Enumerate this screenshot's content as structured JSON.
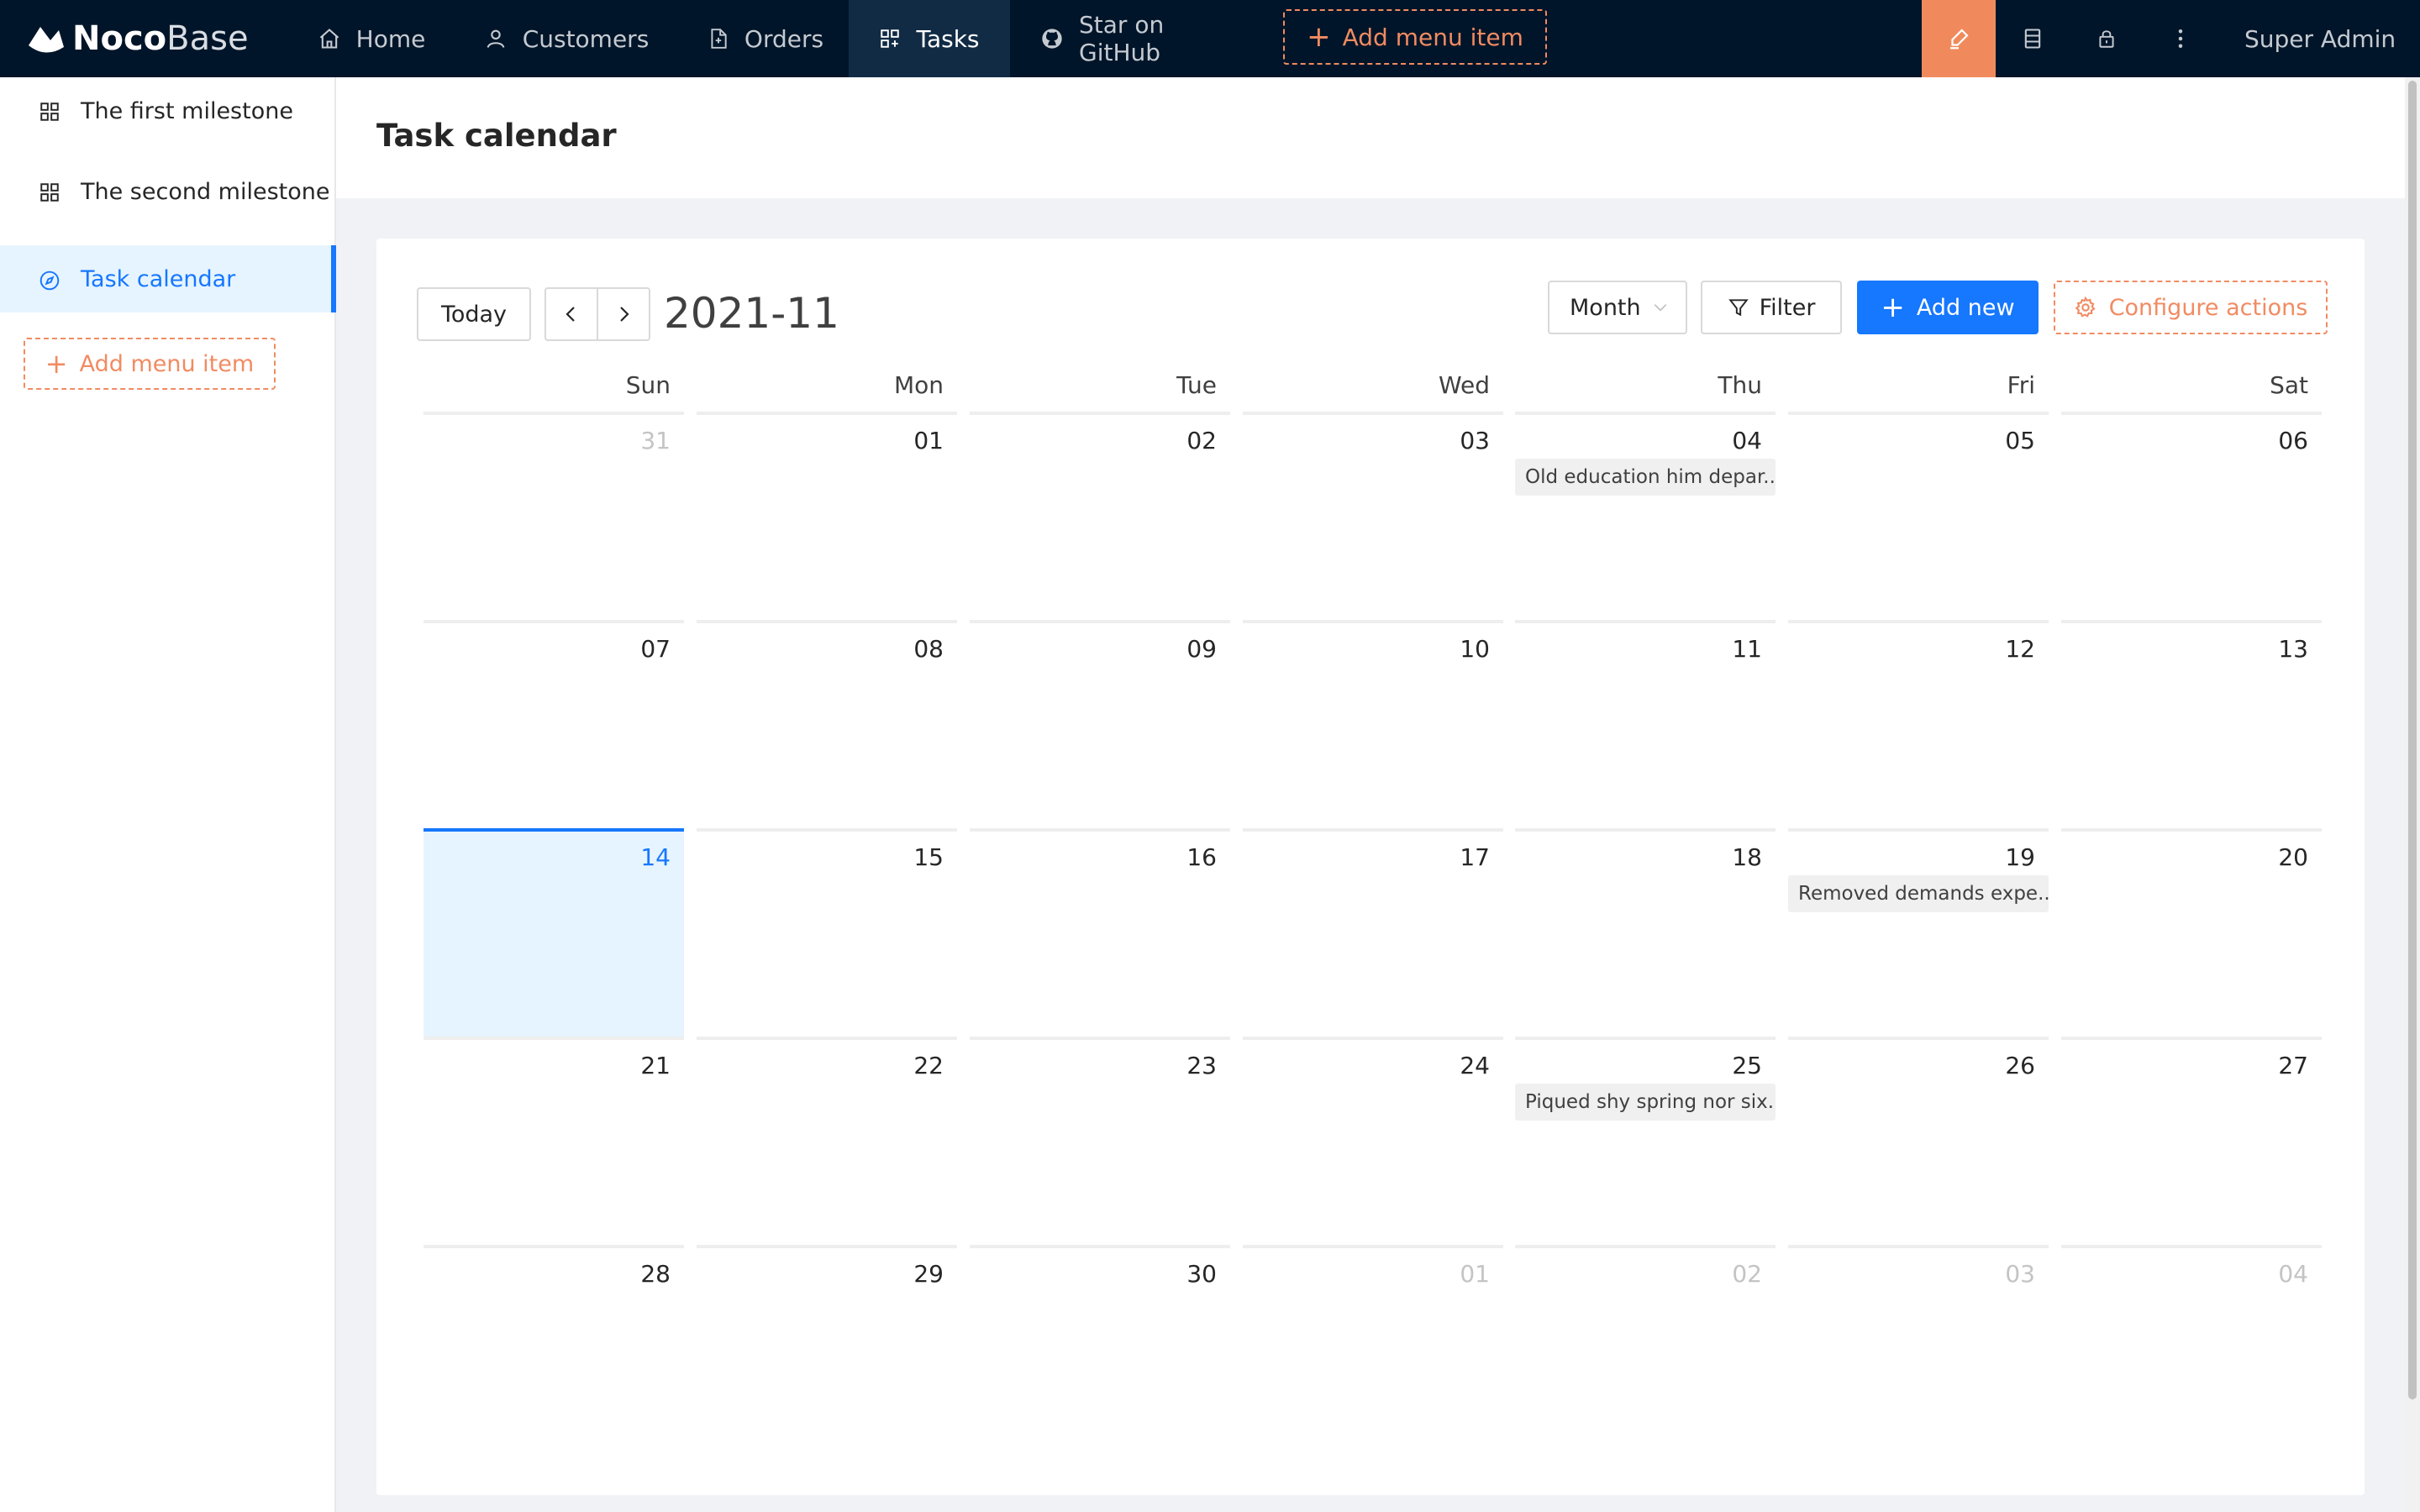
{
  "topbar": {
    "logo_bold": "Noco",
    "logo_light": "Base",
    "nav": [
      {
        "label": "Home",
        "icon": "home-icon"
      },
      {
        "label": "Customers",
        "icon": "user-icon"
      },
      {
        "label": "Orders",
        "icon": "file-icon"
      },
      {
        "label": "Tasks",
        "icon": "appstore-icon",
        "active": true
      },
      {
        "label": "Star on GitHub",
        "icon": "github-icon"
      }
    ],
    "add_menu_item": "Add menu item",
    "tools": [
      "highlight-icon",
      "database-icon",
      "lock-icon",
      "more-icon"
    ],
    "user": "Super Admin",
    "accent": "#f08a5d"
  },
  "sidebar": {
    "items": [
      {
        "label": "The first milestone",
        "icon": "appstore-icon"
      },
      {
        "label": "The second milestone",
        "icon": "appstore-icon"
      },
      {
        "label": "Task calendar",
        "icon": "compass-icon",
        "active": true
      }
    ],
    "add_menu_item": "Add menu item"
  },
  "page": {
    "title": "Task calendar"
  },
  "calendar": {
    "today_label": "Today",
    "title": "2021-11",
    "view": "Month",
    "filter_label": "Filter",
    "add_new_label": "Add new",
    "configure_label": "Configure actions",
    "weekdays": [
      "Sun",
      "Mon",
      "Tue",
      "Wed",
      "Thu",
      "Fri",
      "Sat"
    ],
    "weeks": [
      [
        {
          "d": "31",
          "dim": true
        },
        {
          "d": "01"
        },
        {
          "d": "02"
        },
        {
          "d": "03"
        },
        {
          "d": "04",
          "event": "Old education him depar..."
        },
        {
          "d": "05"
        },
        {
          "d": "06"
        }
      ],
      [
        {
          "d": "07"
        },
        {
          "d": "08"
        },
        {
          "d": "09"
        },
        {
          "d": "10"
        },
        {
          "d": "11"
        },
        {
          "d": "12"
        },
        {
          "d": "13"
        }
      ],
      [
        {
          "d": "14",
          "today": true
        },
        {
          "d": "15"
        },
        {
          "d": "16"
        },
        {
          "d": "17"
        },
        {
          "d": "18"
        },
        {
          "d": "19",
          "event": "Removed demands expe..."
        },
        {
          "d": "20"
        }
      ],
      [
        {
          "d": "21"
        },
        {
          "d": "22"
        },
        {
          "d": "23"
        },
        {
          "d": "24"
        },
        {
          "d": "25",
          "event": "Piqued shy spring nor six..."
        },
        {
          "d": "26"
        },
        {
          "d": "27"
        }
      ],
      [
        {
          "d": "28"
        },
        {
          "d": "29"
        },
        {
          "d": "30"
        },
        {
          "d": "01",
          "dim": true
        },
        {
          "d": "02",
          "dim": true
        },
        {
          "d": "03",
          "dim": true
        },
        {
          "d": "04",
          "dim": true
        }
      ]
    ],
    "primary_color": "#1677ff"
  }
}
